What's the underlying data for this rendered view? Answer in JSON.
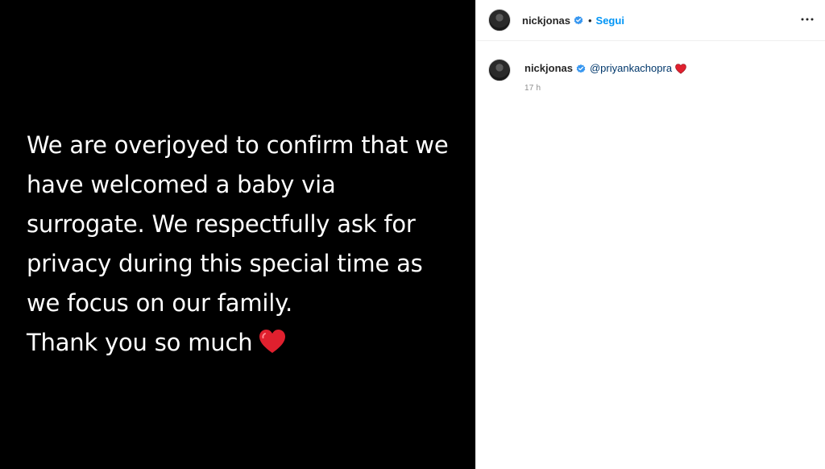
{
  "post": {
    "media": {
      "lines": [
        "We are overjoyed to confirm that we",
        "have welcomed a baby via",
        "surrogate. We respectfully ask for",
        "privacy during this special time as",
        "we focus on our family.",
        "Thank you so much"
      ],
      "emoji": "red-heart-icon"
    },
    "header": {
      "username": "nickjonas",
      "separator": "•",
      "follow_label": "Segui",
      "more_icon": "more-options-icon"
    },
    "caption": {
      "username": "nickjonas",
      "mention": "@priyankachopra",
      "emoji": "red-heart-icon",
      "time": "17 h"
    }
  },
  "colors": {
    "media_background": "#000000",
    "accent_blue": "#0095f6",
    "verified_blue": "#3897f0",
    "mention": "#00376b",
    "heart_red": "#e0202e",
    "secondary_text": "#8e8e8e"
  }
}
